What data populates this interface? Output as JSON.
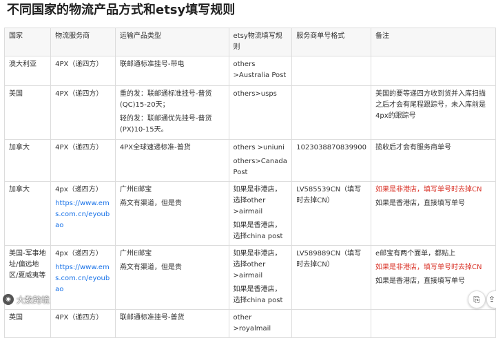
{
  "title": "不同国家的物流产品方式和etsy填写规则",
  "table": {
    "headers": [
      "国家",
      "物流服务商",
      "运输产品类型",
      "etsy物流填写规则",
      "服务商单号格式",
      "备注"
    ],
    "rows": [
      {
        "country": "澳大利亚",
        "provider": [
          "4PX（递四方）"
        ],
        "product": [
          "联邮通标准挂号-带电"
        ],
        "etsy": [
          "others >Australia Post"
        ],
        "tracking": "",
        "note": []
      },
      {
        "country": "美国",
        "provider": [
          "4PX（递四方）"
        ],
        "product": [
          "重的发：联邮通标准挂号-普货(QC)15-20天；",
          "轻的发：联邮通优先挂号-普货(PX)10-15天。"
        ],
        "etsy": [
          "others>usps"
        ],
        "tracking": "",
        "note": [
          "美国的要等递四方收到货并入库扫描之后才会有尾程跟踪号，未入库前是4px的跟踪号"
        ]
      },
      {
        "country": "加拿大",
        "provider": [
          "4PX（递四方）"
        ],
        "product": [
          "4PX全球速递标准-普货"
        ],
        "etsy": [
          "others >uniuni",
          "others>CanadaPost"
        ],
        "tracking": "1023038870839900",
        "note": [
          "揽收后才会有服务商单号"
        ]
      },
      {
        "country": "加拿大",
        "provider": [
          "4px（递四方）"
        ],
        "provider_link": "https://www.ems.com.cn/eyoubao",
        "product": [
          "广州E邮宝",
          "燕文有渠道，但是贵"
        ],
        "etsy": [
          "如果是非港店，选择other >airmail",
          "如果是香港店，选择china post"
        ],
        "tracking": "LV585539CN（填写时去掉CN）",
        "note_red": "如果是非港店，填写单号时去掉CN",
        "note": [
          "如果是香港店，直接填写单号"
        ]
      },
      {
        "country": "美国-军事地址/偏远地区/夏威夷等",
        "provider": [
          "4px（递四方）"
        ],
        "provider_link": "https://www.ems.com.cn/eyoubao",
        "product": [
          "广州E邮宝",
          "燕文有渠道，但是贵"
        ],
        "etsy": [
          "如果是非港店，选择other >airmail",
          "如果是香港店，选择china post"
        ],
        "tracking": "LV589889CN（填写时去掉CN）",
        "note_top": "e邮宝有两个面单，都贴上",
        "note_red": "如果是非港店，填写单号时去掉CN",
        "note": [
          "如果是香港店，直接填写单号"
        ]
      },
      {
        "country": "英国",
        "provider": [
          "4PX（递四方）"
        ],
        "product": [
          "联邮通标准挂号-普货"
        ],
        "etsy": [
          "other >royalmail"
        ],
        "tracking": "",
        "note": []
      }
    ]
  },
  "footer": {
    "logo_text": "大数跨境",
    "logo_glyph": "◉"
  },
  "fab": [
    {
      "icon": "copy-icon",
      "glyph": "⎘"
    },
    {
      "icon": "share-icon",
      "glyph": "⇪"
    }
  ]
}
